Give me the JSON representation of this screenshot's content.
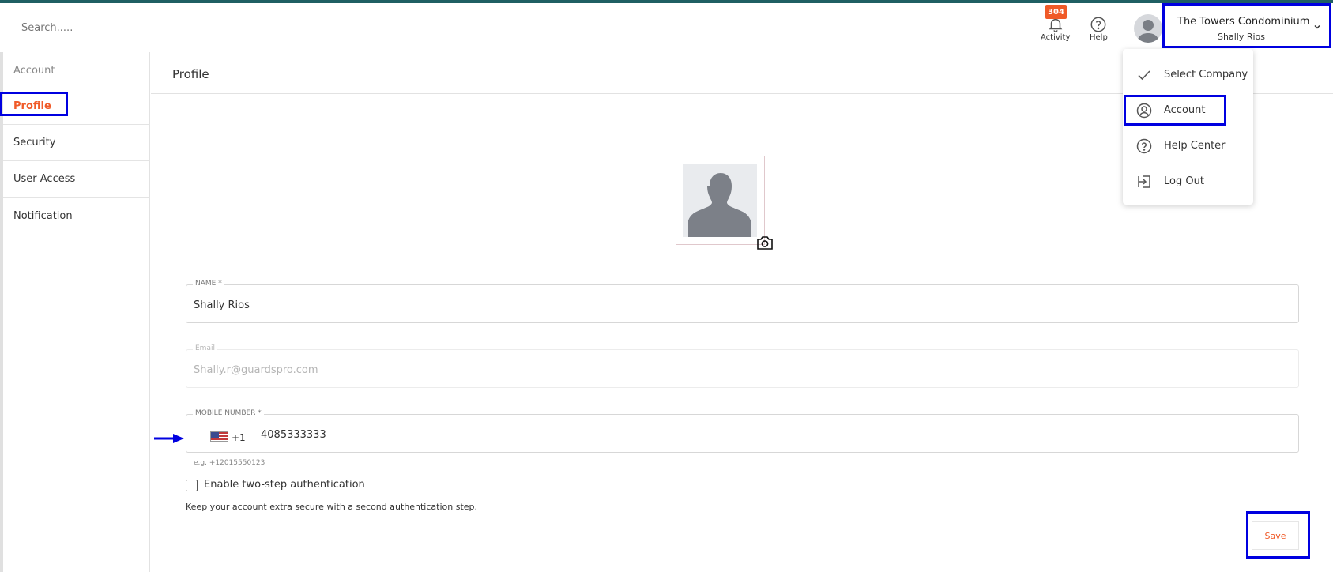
{
  "search": {
    "placeholder": "Search....."
  },
  "header": {
    "activity_label": "Activity",
    "activity_count": "304",
    "help_label": "Help",
    "company_name": "The Towers Condominium",
    "user_name": "Shally Rios"
  },
  "user_menu": {
    "items": [
      {
        "label": "Select Company",
        "icon": "check-icon"
      },
      {
        "label": "Account",
        "icon": "user-circle-icon"
      },
      {
        "label": "Help Center",
        "icon": "help-circle-icon"
      },
      {
        "label": "Log Out",
        "icon": "logout-icon"
      }
    ]
  },
  "sidebar": {
    "items": [
      {
        "label": "Account"
      },
      {
        "label": "Profile"
      },
      {
        "label": "Security"
      },
      {
        "label": "User Access"
      },
      {
        "label": "Notification"
      }
    ]
  },
  "main": {
    "title": "Profile",
    "name_label": "NAME *",
    "name_value": "Shally Rios",
    "email_label": "Email",
    "email_value": "Shally.r@guardspro.com",
    "mobile_label": "MOBILE NUMBER *",
    "dial_code": "+1",
    "mobile_value": "4085333333",
    "mobile_hint": "e.g. +12015550123",
    "two_step_label": "Enable two-step authentication",
    "two_step_note": "Keep your account extra secure with a second authentication step.",
    "save_label": "Save"
  },
  "colors": {
    "accent": "#f05a28",
    "topbar": "#1f5f63",
    "highlight": "#0000e0"
  }
}
